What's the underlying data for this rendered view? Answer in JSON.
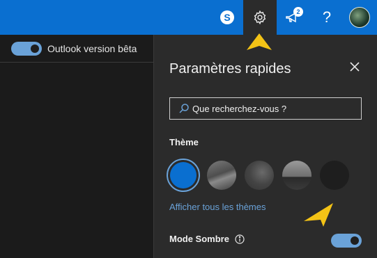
{
  "header": {
    "notifications_count": "2",
    "help_label": "?"
  },
  "left": {
    "toggle_label": "Outlook version bêta",
    "toggle_on": true
  },
  "panel": {
    "title": "Paramètres rapides",
    "search": {
      "placeholder": "Que recherchez-vous ?"
    },
    "theme_section": "Thème",
    "themes": [
      "blue",
      "mountain",
      "abstract",
      "palms",
      "dark"
    ],
    "selected_theme": "blue",
    "show_all_themes": "Afficher tous les thèmes",
    "dark_mode_label": "Mode Sombre",
    "dark_mode_on": true
  },
  "colors": {
    "accent": "#0a6fd0",
    "link": "#6aa2d8",
    "arrow": "#f3c316"
  },
  "icons": [
    "skype-icon",
    "gear-icon",
    "megaphone-icon",
    "help-icon",
    "avatar",
    "close-icon",
    "search-icon",
    "info-icon"
  ]
}
